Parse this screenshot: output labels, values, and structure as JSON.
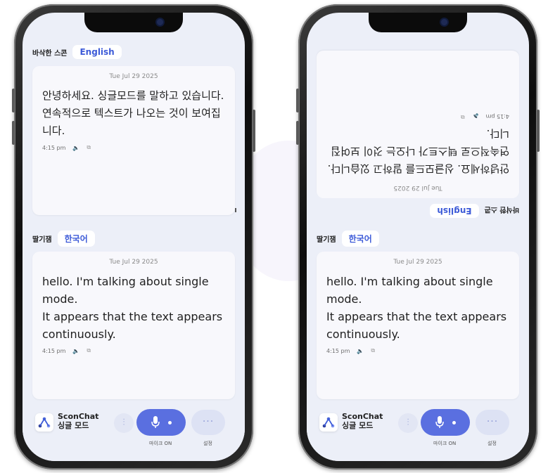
{
  "left_phone": {
    "top_section": {
      "speaker": "바삭한 스콘",
      "language": "English",
      "date": "Tue Jul 29 2025",
      "message": "안녕하세요. 싱글모드를 말하고 있습니다.\n연속적으로 텍스트가 나오는 것이 보여집니다.",
      "time": "4:15 pm"
    },
    "bottom_section": {
      "speaker": "딸기잼",
      "language": "한국어",
      "date": "Tue Jul 29 2025",
      "message": "hello. I'm talking about single mode.\nIt appears that the text appears continuously.",
      "time": "4:15 pm"
    },
    "toolbar": {
      "app_name": "SconChat",
      "mode": "싱글 모드",
      "mic_label": "마이크 ON",
      "settings_label": "설정"
    }
  },
  "right_phone": {
    "top_section": {
      "speaker": "바삭한 스콘",
      "language": "English",
      "date": "Tue Jul 29 2025",
      "message": "안녕하세요. 싱글모드를 말하고 있습니다.\n연속적으로 텍스트가 나오는 것이 보여집니다.",
      "time": "4:15 pm",
      "flipped": true
    },
    "bottom_section": {
      "speaker": "딸기잼",
      "language": "한국어",
      "date": "Tue Jul 29 2025",
      "message": "hello. I'm talking about single mode.\nIt appears that the text appears continuously.",
      "time": "4:15 pm"
    },
    "toolbar": {
      "app_name": "SconChat",
      "mode": "싱글 모드",
      "mic_label": "마이크 ON",
      "settings_label": "설정"
    }
  },
  "icons": {
    "speaker": "speaker-icon",
    "copy": "copy-icon",
    "logo": "sconchat-logo-icon",
    "tune": "tune-icon",
    "mic": "mic-icon",
    "more": "more-icon"
  },
  "colors": {
    "accent": "#5a6fe0",
    "chip_text": "#3d5bd8",
    "screen_bg": "#eceff8"
  }
}
